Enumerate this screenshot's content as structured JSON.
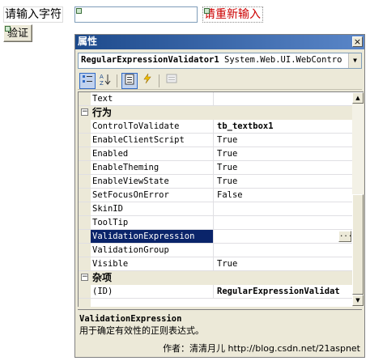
{
  "form": {
    "prompt_label": "请输入字符",
    "textbox_value": "",
    "error_message": "请重新输入",
    "verify_button": "验证"
  },
  "properties": {
    "title": "属性",
    "close": "×",
    "object_name": "RegularExpressionValidator1",
    "object_type": "System.Web.UI.WebContro"
  },
  "toolbar": [
    "categorized-icon",
    "alphabetical-icon",
    "properties-icon",
    "events-icon",
    "property-pages-icon"
  ],
  "grid": {
    "rows": [
      {
        "type": "prop",
        "name": "Text",
        "value": ""
      },
      {
        "type": "cat",
        "name": "行为",
        "toggle": "−"
      },
      {
        "type": "prop",
        "name": "ControlToValidate",
        "value": "tb_textbox1",
        "bold": true
      },
      {
        "type": "prop",
        "name": "EnableClientScript",
        "value": "True"
      },
      {
        "type": "prop",
        "name": "Enabled",
        "value": "True"
      },
      {
        "type": "prop",
        "name": "EnableTheming",
        "value": "True"
      },
      {
        "type": "prop",
        "name": "EnableViewState",
        "value": "True"
      },
      {
        "type": "prop",
        "name": "SetFocusOnError",
        "value": "False"
      },
      {
        "type": "prop",
        "name": "SkinID",
        "value": ""
      },
      {
        "type": "prop",
        "name": "ToolTip",
        "value": ""
      },
      {
        "type": "prop",
        "name": "ValidationExpression",
        "value": "",
        "selected": true,
        "ellipsis": "..."
      },
      {
        "type": "prop",
        "name": "ValidationGroup",
        "value": ""
      },
      {
        "type": "prop",
        "name": "Visible",
        "value": "True"
      },
      {
        "type": "cat",
        "name": "杂项",
        "toggle": "−"
      },
      {
        "type": "prop",
        "name": "(ID)",
        "value": "RegularExpressionValidat",
        "bold": true
      }
    ]
  },
  "description": {
    "title": "ValidationExpression",
    "text": "用于确定有效性的正则表达式。",
    "credit": "作者：清清月儿 http://blog.csdn.net/21aspnet"
  },
  "colors": {
    "title_bar": "#1d4a8c",
    "selected_row": "#0a246a",
    "error_text": "#cc0000"
  }
}
